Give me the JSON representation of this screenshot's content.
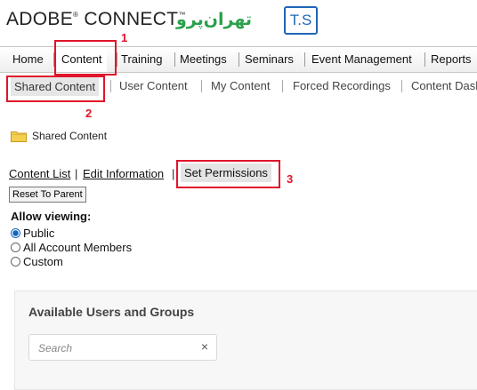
{
  "header": {
    "brand_left": "ADOBE",
    "brand_reg": "®",
    "brand_right": "CONNECT",
    "brand_tm": "™",
    "partner_logo_text": "تهران‌پرو",
    "partner_logo_badge": "T.S"
  },
  "nav": {
    "items": [
      "Home",
      "Content",
      "Training",
      "Meetings",
      "Seminars",
      "Event Management",
      "Reports"
    ]
  },
  "subnav": {
    "items": [
      "Shared Content",
      "User Content",
      "My Content",
      "Forced Recordings",
      "Content Dash"
    ]
  },
  "breadcrumb": {
    "folder_icon": "folder-icon",
    "label": "Shared Content"
  },
  "actions": {
    "content_list": "Content List",
    "edit_information": "Edit Information",
    "set_permissions": "Set Permissions",
    "sep": "|",
    "reset_to_parent": "Reset To Parent"
  },
  "permissions": {
    "allow_viewing_label": "Allow viewing:",
    "options": [
      "Public",
      "All Account Members",
      "Custom"
    ],
    "selected": "Public"
  },
  "users_panel": {
    "title": "Available Users and Groups",
    "search_placeholder": "Search",
    "clear_icon": "×"
  },
  "annotations": {
    "step1": "1",
    "step2": "2",
    "step3": "3",
    "color": "#e0142a"
  }
}
